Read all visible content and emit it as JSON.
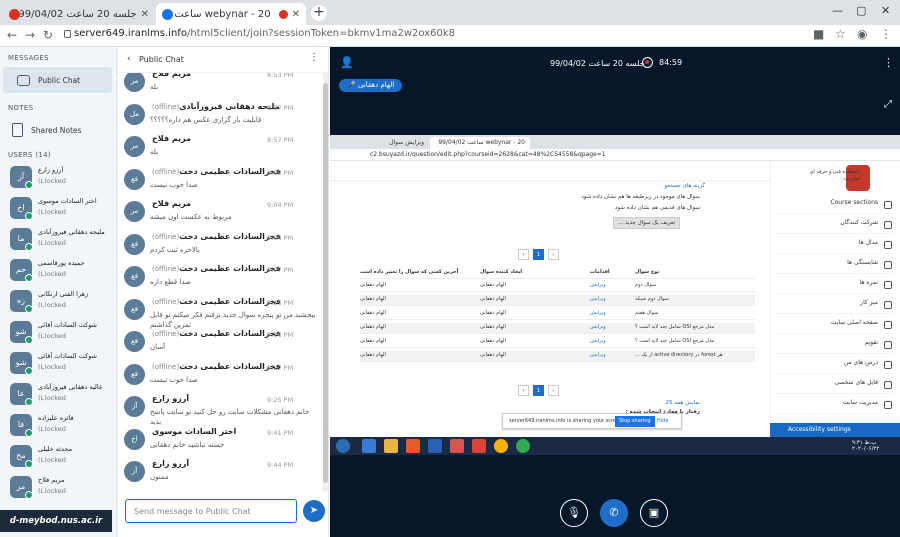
{
  "browser": {
    "tabs": [
      {
        "title": "جلسه 20 ساعت 99/04/02"
      },
      {
        "title": "webynar - 20 ساعت 99/04/02"
      }
    ],
    "url_host": "server649.iranlms.info",
    "url_path": "/html5client/join?sessionToken=bkmv1ma2w2ox60k8"
  },
  "sidebar": {
    "messages_heading": "MESSAGES",
    "public_chat": "Public Chat",
    "notes_heading": "NOTES",
    "shared_notes": "Shared Notes",
    "users_heading": "USERS (14)",
    "users": [
      {
        "initials": "آز",
        "name": "آرزو زارع",
        "status": "(L)ocked"
      },
      {
        "initials": "اخ",
        "name": "اختر السادات موسوی",
        "status": "(L)ocked"
      },
      {
        "initials": "ما",
        "name": "ملیحه دهقانی فیروزآبادی",
        "status": "(L)ocked"
      },
      {
        "initials": "حم",
        "name": "حمیده پورقاسمی",
        "status": "(L)ocked"
      },
      {
        "initials": "زه",
        "name": "زهرا الفتی ارنکانی",
        "status": "(L)ocked"
      },
      {
        "initials": "شو",
        "name": "شوکت السادات آقائی",
        "status": "(L)ocked"
      },
      {
        "initials": "شو",
        "name": "شوکت السادات آقائی",
        "status": "(L)ocked"
      },
      {
        "initials": "عا",
        "name": "عالیه دهقانی فیروزآبادی",
        "status": "(L)ocked"
      },
      {
        "initials": "فا",
        "name": "فائزه علیزاده",
        "status": "(L)ocked"
      },
      {
        "initials": "مح",
        "name": "محدثه خلیلی",
        "status": "(L)ocked"
      },
      {
        "initials": "مر",
        "name": "مریم فلاح",
        "status": "(L)ocked"
      }
    ]
  },
  "chat": {
    "title": "Public Chat",
    "input_placeholder": "Send message to Public Chat",
    "messages": [
      {
        "initials": "مر",
        "sender": "مریم فلاح",
        "badge": "",
        "time": "8:53 PM",
        "text": "بله"
      },
      {
        "initials": "مل",
        "sender": "ملیحه دهقانی فیروزآبادی",
        "badge": "(offline)",
        "time": "8:57 PM",
        "text": "قابلیت بار گزاری عکس هم داره؟؟؟؟؟"
      },
      {
        "initials": "مر",
        "sender": "مریم فلاح",
        "badge": "",
        "time": "8:57 PM",
        "text": "بله"
      },
      {
        "initials": "فع",
        "sender": "فخرالسادات عظیمی دخت",
        "badge": "(offline)",
        "time": "9:03 PM",
        "text": "صدا خوب نیست"
      },
      {
        "initials": "مر",
        "sender": "مریم فلاح",
        "badge": "",
        "time": "9:04 PM",
        "text": "مربوط به عکست اون میشه"
      },
      {
        "initials": "فع",
        "sender": "فخرالسادات عظیمی دخت",
        "badge": "(offline)",
        "time": "9:04 PM",
        "text": "بالاخره ثبت کردم"
      },
      {
        "initials": "فع",
        "sender": "فخرالسادات عظیمی دخت",
        "badge": "(offline)",
        "time": "9:07 PM",
        "text": "صدا قطع داره"
      },
      {
        "initials": "فع",
        "sender": "فخرالسادات عظیمی دخت",
        "badge": "(offline)",
        "time": "9:15 PM",
        "text": "ببخشید من تو پنجره سوال جدید نرفتم فکر میکنم تو فایل تمرین گذاشتم"
      },
      {
        "initials": "فع",
        "sender": "فخرالسادات عظیمی دخت",
        "badge": "(offline)",
        "time": "9:16 PM",
        "text": "آسان"
      },
      {
        "initials": "فع",
        "sender": "فخرالسادات عظیمی دخت",
        "badge": "(offline)",
        "time": "9:22 PM",
        "text": "صدا خوب نیست"
      },
      {
        "initials": "آز",
        "sender": "آرزو زارع",
        "badge": "",
        "time": "9:25 PM",
        "text": "خانم دهقانی مشکلات سایت رو حل کنید تو سایت پاسخ بدید"
      },
      {
        "initials": "اخ",
        "sender": "اختر السادات موسوی",
        "badge": "",
        "time": "9:41 PM",
        "text": "خسته نباشید خانم دهقانی"
      },
      {
        "initials": "آز",
        "sender": "آرزو زارع",
        "badge": "",
        "time": "9:44 PM",
        "text": "ممنون"
      }
    ]
  },
  "presentation": {
    "session_title": "جلسه 20 ساعت 99/04/02",
    "timer": "84:59",
    "talking_badge": "الهام دهقانی"
  },
  "shared_screen": {
    "tab_a": "ویرایش سوال",
    "tab_b": "webynar - 20 ساعت 99/04/02",
    "url": "c2.bsuyazd.ir/question/edit.php?courseid=2628&cat=48%2C54558&qpage=1",
    "logo_text": "دانشکده فنی و حرفه ای امام یزد",
    "heading_options": "گزینه های جستجو",
    "opt_1": "سوال های موجود در زیرطبقه ها هم نشان داده شود",
    "opt_2": "سوال های قدیمی هم نشان داده شود",
    "new_question_btn": "تعریف یک سوال جدید ...",
    "page_num": "1",
    "col_type": "نوع سوال",
    "col_name": "نام سوال / ID number",
    "col_actions": "اقدامات",
    "col_created": "ایجاد کننده سوال",
    "col_modified": "آخرین کسی که سوال را تغییر داده است",
    "rows": [
      {
        "name": "سوال دوم",
        "action": "ویرایش",
        "created": "الهام دهقانی",
        "modified": "الهام دهقانی"
      },
      {
        "name": "سوال دوم شبکه",
        "action": "ویرایش",
        "created": "الهام دهقانی",
        "modified": "الهام دهقانی"
      },
      {
        "name": "سوال هفتم",
        "action": "ویرایش",
        "created": "الهام دهقانی",
        "modified": "الهام دهقانی"
      },
      {
        "name": "مدل مرجع OSI شامل چند لایه است ؟",
        "action": "ویرایش",
        "created": "الهام دهقانی",
        "modified": "الهام دهقانی"
      },
      {
        "name": "مدل مرجع OSI شامل چند لایه است ؟",
        "action": "ویرایش",
        "created": "الهام دهقانی",
        "modified": "الهام دهقانی"
      },
      {
        "name": "هر forest در active directory از یک ...",
        "action": "ویرایش",
        "created": "الهام دهقانی",
        "modified": "الهام دهقانی"
      }
    ],
    "show_all": "نمایش همه 25",
    "with_selected": "رفتار با موارد انتخاب شده :",
    "share_msg": "server649.iranlms.info is sharing your screen.",
    "stop_sharing": "Stop sharing",
    "hide": "Hide",
    "side": [
      "Course sections",
      "شرکت کنندگان",
      "مدال ها",
      "شایستگی ها",
      "نمره ها",
      "میز کار",
      "صفحه اصلی سایت",
      "تقویم",
      "درس های من",
      "فایل های شخصی",
      "مدیریت سایت"
    ],
    "accessibility": "Accessibility settings",
    "clock": "۹:۳۱ ب.ظ\n۲۰۲۰/۰۶/۲۲"
  },
  "watermark": "d-meybod.nus.ac.ir"
}
